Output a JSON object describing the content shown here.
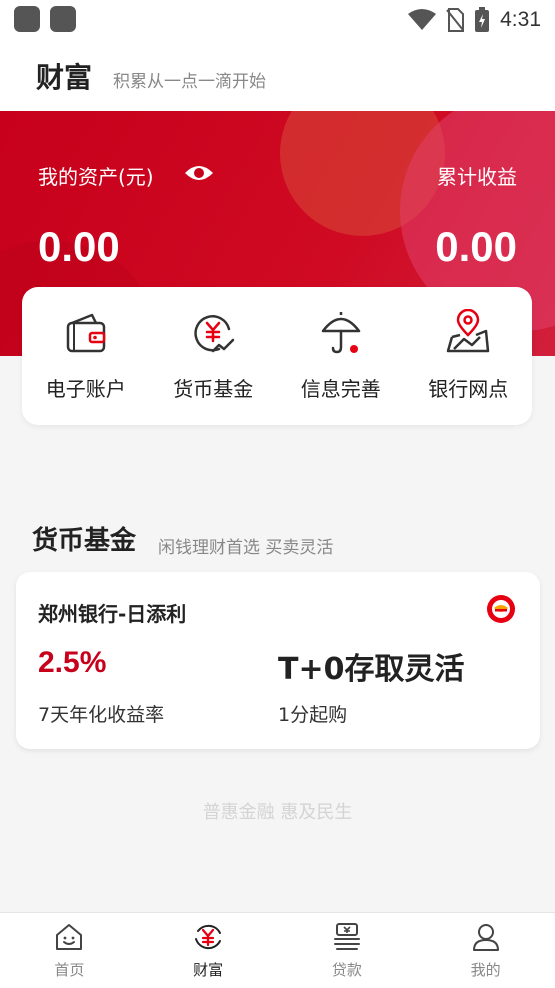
{
  "status_bar": {
    "time": "4:31"
  },
  "header": {
    "title": "财富",
    "subtitle": "积累从一点一滴开始"
  },
  "assets": {
    "label": "我的资产(元)",
    "value": "0.00",
    "earnings_label": "累计收益",
    "earnings_value": "0.00"
  },
  "quick_actions": [
    {
      "label": "电子账户",
      "icon": "wallet-icon"
    },
    {
      "label": "货币基金",
      "icon": "yuan-coin-icon"
    },
    {
      "label": "信息完善",
      "icon": "umbrella-icon"
    },
    {
      "label": "银行网点",
      "icon": "map-pin-icon"
    }
  ],
  "section": {
    "title": "货币基金",
    "subtitle": "闲钱理财首选 买卖灵活"
  },
  "fund": {
    "name": "郑州银行-日添利",
    "rate": "2.5%",
    "rate_label": "7天年化收益率",
    "feature": "T+0存取灵活",
    "min_label": "1分起购"
  },
  "slogan": "普惠金融 惠及民生",
  "bottom_nav": [
    {
      "label": "首页",
      "icon": "home-icon",
      "active": false
    },
    {
      "label": "财富",
      "icon": "wealth-icon",
      "active": true
    },
    {
      "label": "贷款",
      "icon": "loan-icon",
      "active": false
    },
    {
      "label": "我的",
      "icon": "profile-icon",
      "active": false
    }
  ],
  "colors": {
    "brand": "#c7001b",
    "accent_dot": "#e60012"
  }
}
